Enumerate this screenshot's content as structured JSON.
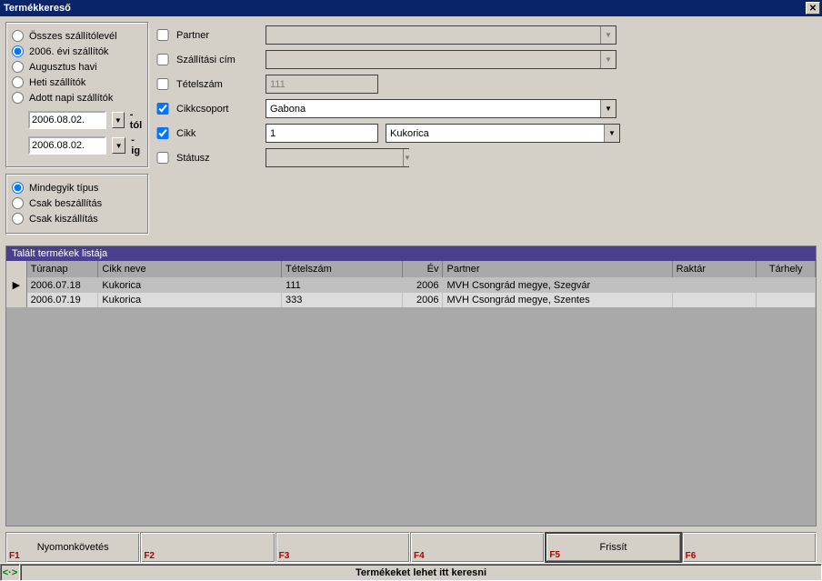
{
  "window": {
    "title": "Termékkereső"
  },
  "filters": {
    "radios": [
      {
        "label": "Összes szállítólevél",
        "checked": false
      },
      {
        "label": "2006. évi szállítók",
        "checked": true
      },
      {
        "label": "Augusztus havi",
        "checked": false
      },
      {
        "label": "Heti szállítók",
        "checked": false
      },
      {
        "label": "Adott napi szállítók",
        "checked": false
      }
    ],
    "date_from": "2006.08.02.",
    "date_from_suffix": "-tól",
    "date_to": "2006.08.02.",
    "date_to_suffix": "-ig",
    "type_radios": [
      {
        "label": "Mindegyik típus",
        "checked": true
      },
      {
        "label": "Csak beszállítás",
        "checked": false
      },
      {
        "label": "Csak kiszállítás",
        "checked": false
      }
    ]
  },
  "form": {
    "partner": {
      "label": "Partner",
      "checked": false,
      "value": ""
    },
    "szcim": {
      "label": "Szállítási cím",
      "checked": false,
      "value": ""
    },
    "tetel": {
      "label": "Tételszám",
      "checked": false,
      "value": "111"
    },
    "cikkcsoport": {
      "label": "Cikkcsoport",
      "checked": true,
      "value": "Gabona"
    },
    "cikk": {
      "label": "Cikk",
      "checked": true,
      "code": "1",
      "name": "Kukorica"
    },
    "status": {
      "label": "Státusz",
      "checked": false,
      "value": ""
    }
  },
  "results": {
    "title": "Talált termékek listája",
    "columns": [
      "",
      "Túranap",
      "Cikk neve",
      "Tételszám",
      "Év",
      "Partner",
      "Raktár",
      "Tárhely"
    ],
    "rows": [
      {
        "indicator": "▶",
        "turanap": "2006.07.18",
        "cikknev": "Kukorica",
        "tetel": "111",
        "ev": "2006",
        "partner": "MVH Csongrád megye, Szegvár",
        "raktar": "",
        "tarhely": ""
      },
      {
        "indicator": "",
        "turanap": "2006.07.19",
        "cikknev": "Kukorica",
        "tetel": "333",
        "ev": "2006",
        "partner": "MVH Csongrád megye, Szentes",
        "raktar": "",
        "tarhely": ""
      }
    ]
  },
  "fnkeys": {
    "f1": "Nyomonkövetés",
    "f2": "",
    "f3": "",
    "f4": "",
    "f5": "Frissít",
    "f6": ""
  },
  "status": {
    "resize_glyph": "<·>",
    "message": "Termékeket lehet itt keresni"
  }
}
